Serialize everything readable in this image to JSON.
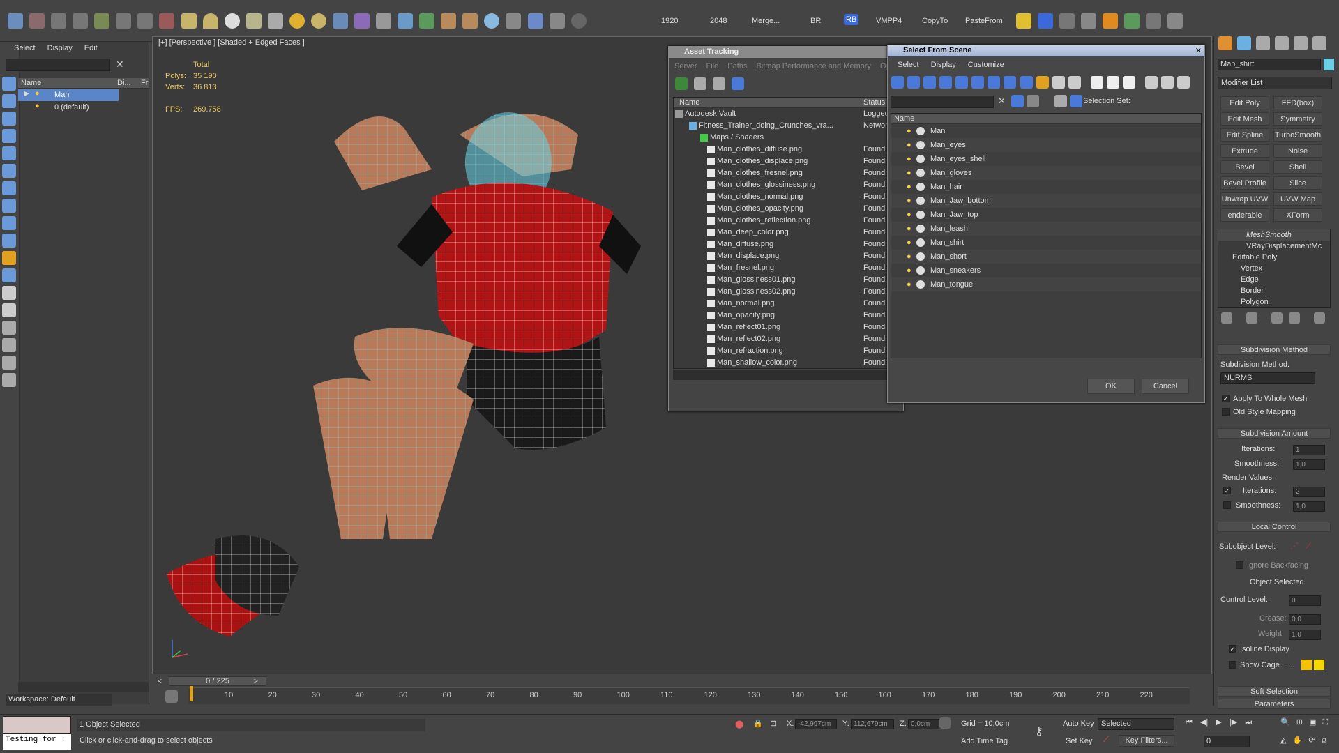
{
  "toolbar": {
    "items": [
      "1920",
      "2048",
      "Merge...",
      "BR",
      "RB",
      "VMPP4",
      "CopyTo",
      "PasteFrom"
    ]
  },
  "explorer": {
    "menu": [
      "Select",
      "Display",
      "Edit"
    ],
    "col_name": "Name",
    "col_display": "Di...",
    "col_freeze": "Fr",
    "rows": [
      "Man",
      "0 (default)"
    ],
    "workspace": "Workspace: Default"
  },
  "viewport": {
    "label": "[+] [Perspective ] [Shaded + Edged Faces ]",
    "stats": {
      "total": "Total",
      "polys_label": "Polys:",
      "polys": "35 190",
      "verts_label": "Verts:",
      "verts": "36 813",
      "fps_label": "FPS:",
      "fps": "269.758"
    }
  },
  "asset_tracking": {
    "title": "Asset Tracking",
    "menu": [
      "Server",
      "File",
      "Paths",
      "Bitmap Performance and Memory",
      "Optic"
    ],
    "col_name": "Name",
    "col_status": "Status",
    "rows": [
      {
        "name": "Autodesk Vault",
        "status": "Logged"
      },
      {
        "name": "Fitness_Trainer_doing_Crunches_vra...",
        "status": "Networ"
      },
      {
        "name": "Maps / Shaders",
        "status": ""
      },
      {
        "name": "Man_clothes_diffuse.png",
        "status": "Found"
      },
      {
        "name": "Man_clothes_displace.png",
        "status": "Found"
      },
      {
        "name": "Man_clothes_fresnel.png",
        "status": "Found"
      },
      {
        "name": "Man_clothes_glossiness.png",
        "status": "Found"
      },
      {
        "name": "Man_clothes_normal.png",
        "status": "Found"
      },
      {
        "name": "Man_clothes_opacity.png",
        "status": "Found"
      },
      {
        "name": "Man_clothes_reflection.png",
        "status": "Found"
      },
      {
        "name": "Man_deep_color.png",
        "status": "Found"
      },
      {
        "name": "Man_diffuse.png",
        "status": "Found"
      },
      {
        "name": "Man_displace.png",
        "status": "Found"
      },
      {
        "name": "Man_fresnel.png",
        "status": "Found"
      },
      {
        "name": "Man_glossiness01.png",
        "status": "Found"
      },
      {
        "name": "Man_glossiness02.png",
        "status": "Found"
      },
      {
        "name": "Man_normal.png",
        "status": "Found"
      },
      {
        "name": "Man_opacity.png",
        "status": "Found"
      },
      {
        "name": "Man_reflect01.png",
        "status": "Found"
      },
      {
        "name": "Man_reflect02.png",
        "status": "Found"
      },
      {
        "name": "Man_refraction.png",
        "status": "Found"
      },
      {
        "name": "Man_shallow_color.png",
        "status": "Found"
      }
    ]
  },
  "select_from_scene": {
    "title": "Select From Scene",
    "menu": [
      "Select",
      "Display",
      "Customize"
    ],
    "selection_set_label": "Selection Set:",
    "col_name": "Name",
    "items": [
      "Man",
      "Man_eyes",
      "Man_eyes_shell",
      "Man_gloves",
      "Man_hair",
      "Man_Jaw_bottom",
      "Man_Jaw_top",
      "Man_leash",
      "Man_shirt",
      "Man_short",
      "Man_sneakers",
      "Man_tongue"
    ],
    "ok": "OK",
    "cancel": "Cancel"
  },
  "command_panel": {
    "object_name": "Man_shirt",
    "modifier_list": "Modifier List",
    "mod_buttons": [
      "Edit Poly",
      "FFD(box)",
      "Edit Mesh",
      "Symmetry",
      "Edit Spline",
      "TurboSmooth",
      "Extrude",
      "Noise",
      "Bevel",
      "Shell",
      "Bevel Profile",
      "Slice",
      "Unwrap UVW",
      "UVW Map",
      "enderable Splir",
      "XForm"
    ],
    "stack": [
      "MeshSmooth",
      "VRayDisplacementMc",
      "Editable Poly",
      "Vertex",
      "Edge",
      "Border",
      "Polygon"
    ],
    "subdiv_method_hdr": "Subdivision Method",
    "subdiv_method_lbl": "Subdivision Method:",
    "subdiv_method_val": "NURMS",
    "apply_whole": "Apply To Whole Mesh",
    "old_style": "Old Style Mapping",
    "subdiv_amount_hdr": "Subdivision Amount",
    "iterations_lbl": "Iterations:",
    "iterations": "1",
    "smoothness_lbl": "Smoothness:",
    "smoothness": "1,0",
    "render_values": "Render Values:",
    "r_iterations": "2",
    "r_smoothness": "1,0",
    "local_control_hdr": "Local Control",
    "subobject_level": "Subobject Level:",
    "ignore_backfacing": "Ignore Backfacing",
    "object_selected": "Object Selected",
    "control_level_lbl": "Control Level:",
    "control_level": "0",
    "crease_lbl": "Crease:",
    "crease": "0,0",
    "weight_lbl": "Weight:",
    "weight": "1,0",
    "isoline": "Isoline Display",
    "show_cage": "Show Cage ......",
    "soft_selection": "Soft Selection",
    "parameters": "Parameters"
  },
  "timeline": {
    "frame": "0 / 225",
    "ticks": [
      "10",
      "20",
      "30",
      "40",
      "50",
      "60",
      "70",
      "80",
      "90",
      "100",
      "110",
      "120",
      "130",
      "140",
      "150",
      "160",
      "170",
      "180",
      "190",
      "200",
      "210",
      "220"
    ]
  },
  "status": {
    "maxscript": "Testing for :",
    "objects_selected": "1 Object Selected",
    "prompt": "Click or click-and-drag to select objects",
    "x_lbl": "X:",
    "x": "-42,997cm",
    "y_lbl": "Y:",
    "y": "112,679cm",
    "z_lbl": "Z:",
    "z": "0,0cm",
    "grid": "Grid = 10,0cm",
    "add_time_tag": "Add Time Tag",
    "auto_key": "Auto Key",
    "selected": "Selected",
    "set_key": "Set Key",
    "key_filters": "Key Filters...",
    "frame_field": "0"
  }
}
